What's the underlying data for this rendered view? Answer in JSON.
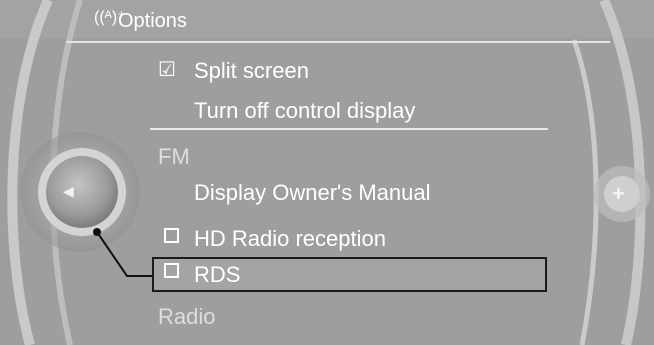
{
  "header": {
    "title": "Options",
    "icon": "antenna-settings-icon"
  },
  "menu": {
    "split_screen": {
      "label": "Split screen",
      "checked": true
    },
    "turn_off_display": {
      "label": "Turn off control display"
    },
    "section_fm": {
      "label": "FM"
    },
    "owners_manual": {
      "label": "Display Owner's Manual"
    },
    "hd_radio": {
      "label": "HD Radio reception",
      "checked": false
    },
    "rds": {
      "label": "RDS",
      "checked": false,
      "selected": true
    },
    "section_radio": {
      "label": "Radio"
    }
  },
  "controls": {
    "back_icon": "left-arrow-icon",
    "plus_icon": "plus-icon"
  },
  "colors": {
    "background": "#9e9e9e",
    "text": "#ffffff",
    "highlight_border": "#1a1a1a"
  }
}
